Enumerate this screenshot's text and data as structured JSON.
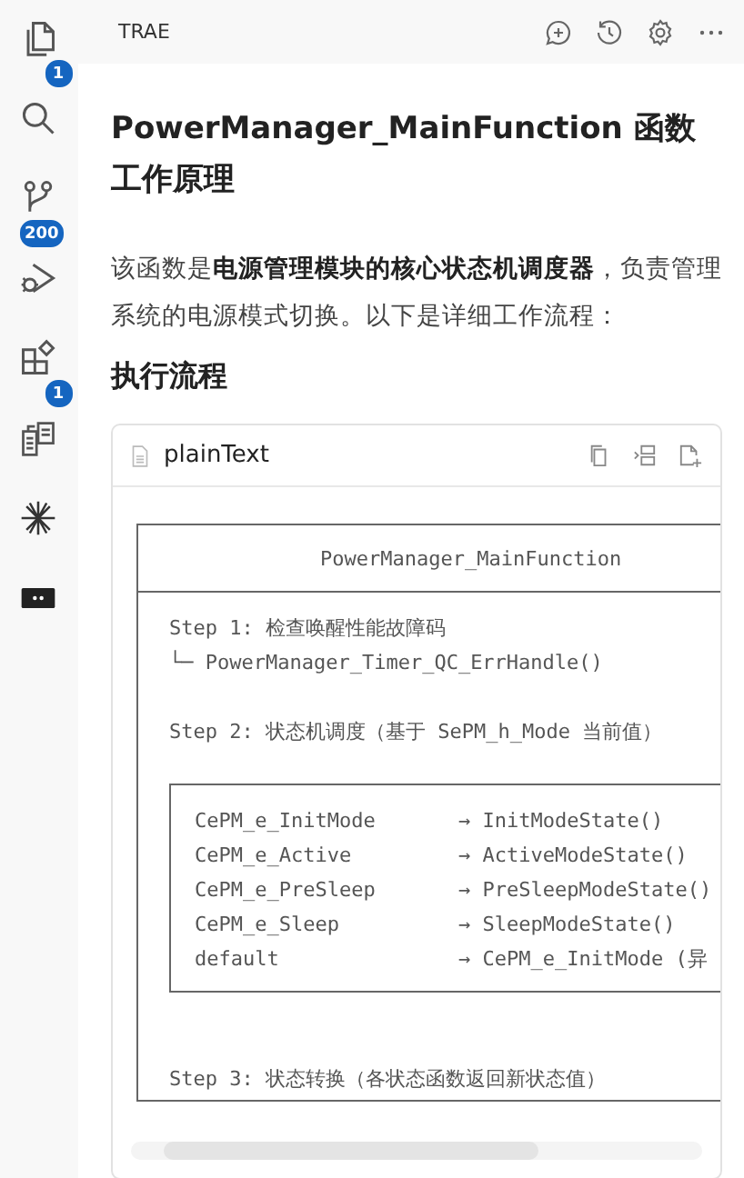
{
  "activity_bar": {
    "items": [
      {
        "kind": "files",
        "badge": "1"
      },
      {
        "kind": "search"
      },
      {
        "kind": "source-control",
        "badge": "200"
      },
      {
        "kind": "debug"
      },
      {
        "kind": "extensions",
        "badge": "1"
      },
      {
        "kind": "clipboard"
      },
      {
        "kind": "sparkle"
      },
      {
        "kind": "terminal"
      }
    ]
  },
  "panel": {
    "title": "TRAE"
  },
  "article": {
    "heading": "PowerManager_MainFunction 函数工作原理",
    "paragraph": "该函数是**电源管理模块的核心状态机调度器**，负责管理系统的电源模式切换。以下是详细工作流程：",
    "subheading": "执行流程",
    "code_block": {
      "language": "plainText",
      "box_title": "PowerManager_MainFunction",
      "lines": [
        {
          "kind": "text",
          "text": "Step 1: 检查唤醒性能故障码"
        },
        {
          "kind": "text",
          "text": "└─ PowerManager_Timer_QC_ErrHandle()"
        },
        {
          "kind": "blank"
        },
        {
          "kind": "text",
          "text": "Step 2: 状态机调度（基于 SePM_h_Mode 当前值）"
        },
        {
          "kind": "blank"
        },
        {
          "kind": "table",
          "rows": [
            {
              "case": "CePM_e_InitMode",
              "action": "→ InitModeState()"
            },
            {
              "case": "CePM_e_Active",
              "action": "→ ActiveModeState()"
            },
            {
              "case": "CePM_e_PreSleep",
              "action": "→ PreSleepModeState()"
            },
            {
              "case": "CePM_e_Sleep",
              "action": "→ SleepModeState()"
            },
            {
              "case": "default",
              "action": "→ CePM_e_InitMode (异"
            }
          ]
        },
        {
          "kind": "blank"
        },
        {
          "kind": "blank"
        },
        {
          "kind": "text",
          "text": "Step 3: 状态转换（各状态函数返回新状态值）"
        }
      ]
    }
  }
}
